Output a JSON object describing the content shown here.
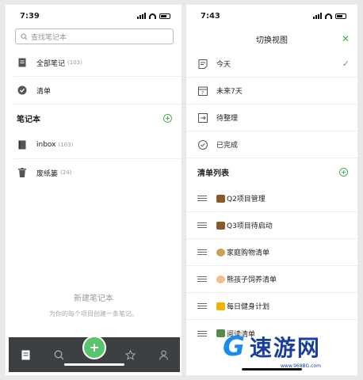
{
  "left": {
    "time": "7:39",
    "search_placeholder": "查找笔记本",
    "items": [
      {
        "label": "全部笔记",
        "count": "(103)"
      },
      {
        "label": "清单",
        "count": ""
      }
    ],
    "section_title": "笔记本",
    "notebooks": [
      {
        "label": "inbox",
        "count": "(103)"
      },
      {
        "label": "废纸篓",
        "count": "(24)"
      }
    ],
    "empty_title": "新建笔记本",
    "empty_desc": "为你的每个项目创建一条笔记。"
  },
  "right": {
    "time": "7:43",
    "title": "切换视图",
    "views": [
      {
        "label": "今天",
        "icon": "today-icon",
        "selected": true
      },
      {
        "label": "未来7天",
        "icon": "calendar-icon",
        "selected": false
      },
      {
        "label": "待整理",
        "icon": "inbox-icon",
        "selected": false
      },
      {
        "label": "已完成",
        "icon": "check-circle-icon",
        "selected": false
      }
    ],
    "list_title": "清单列表",
    "lists": [
      {
        "label": "Q2项目管理",
        "emoji_color": "#8b5a2b"
      },
      {
        "label": "Q3项目待启动",
        "emoji_color": "#8b5a2b"
      },
      {
        "label": "家庭购物清单",
        "emoji_color": "#c8a25a"
      },
      {
        "label": "熊孩子饲养清单",
        "emoji_color": "#f0c08a"
      },
      {
        "label": "每日健身计划",
        "emoji_color": "#f0b400"
      },
      {
        "label": "阅读清单",
        "emoji_color": "#5a8a4a"
      }
    ],
    "watermark": "速游网",
    "watermark_url": "www.968BG.com"
  },
  "colors": {
    "accent": "#4caf50",
    "fab": "#5ac46d",
    "tabbar": "#3c4043"
  }
}
